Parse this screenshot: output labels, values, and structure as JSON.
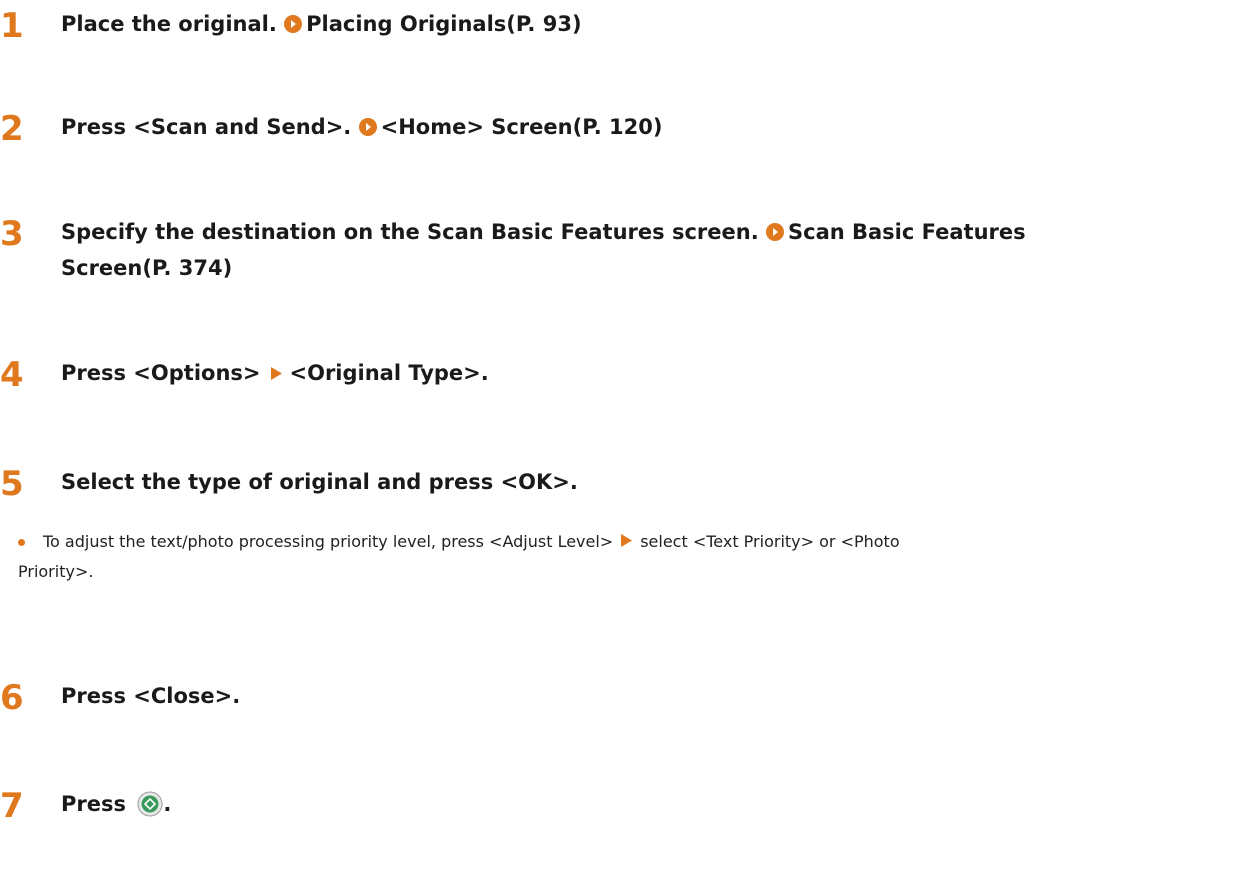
{
  "steps": [
    {
      "number": "1",
      "text": "Place the original.",
      "link": "Placing Originals(P. 93)"
    },
    {
      "number": "2",
      "text": "Press <Scan and Send>.",
      "link": "<Home> Screen(P. 120)"
    },
    {
      "number": "3",
      "text": "Specify the destination on the Scan Basic Features screen.",
      "link_line1": "Scan Basic Features",
      "link_line2": "Screen(P. 374)"
    },
    {
      "number": "4",
      "text_a": "Press <Options>",
      "text_b": "<Original Type>."
    },
    {
      "number": "5",
      "text": "Select the type of original and press <OK>."
    },
    {
      "number": "6",
      "text": "Press <Close>."
    },
    {
      "number": "7",
      "text_a": "Press",
      "text_b": "."
    }
  ],
  "note": {
    "line1_a": "To adjust the text/photo processing priority level, press <Adjust Level>",
    "line1_b": "select <Text Priority> or <Photo",
    "line2": "Priority>."
  },
  "icons": {
    "reference": "circle-arrow-reference-icon",
    "menu_arrow": "orange-triangle-arrow-icon",
    "start": "start-button-icon"
  },
  "colors": {
    "accent": "#e0781e",
    "start_green": "#3a9a5a"
  }
}
